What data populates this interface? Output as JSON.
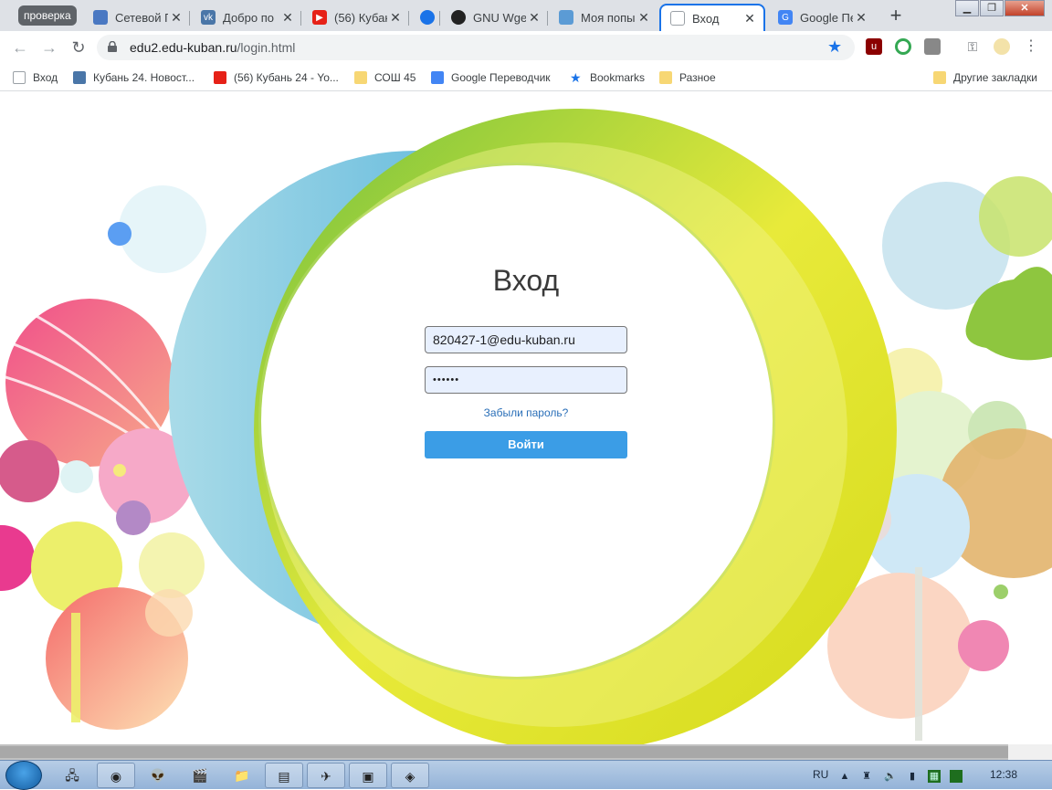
{
  "browser": {
    "tab_group_label": "проверка",
    "tabs": [
      {
        "title": "Сетевой Г",
        "icon": "grid-doc-icon"
      },
      {
        "title": "Добро по",
        "icon": "vk-icon"
      },
      {
        "title": "(56) Кубан",
        "icon": "youtube-icon"
      },
      {
        "title": "",
        "icon": "blue-dot-icon"
      },
      {
        "title": "GNU Wget",
        "icon": "gnu-icon"
      },
      {
        "title": "Моя попы",
        "icon": "puzzle-icon"
      },
      {
        "title": "Вход",
        "icon": "page-icon",
        "active": true
      },
      {
        "title": "Google Пе",
        "icon": "google-translate-icon"
      }
    ],
    "url_host": "edu2.edu-kuban.ru",
    "url_path": "/login.html",
    "bookmarks": [
      {
        "label": "Вход",
        "icon": "page-icon"
      },
      {
        "label": "Кубань 24. Новост...",
        "icon": "vk-icon"
      },
      {
        "label": "(56) Кубань 24 - Yo...",
        "icon": "youtube-icon"
      },
      {
        "label": "СОШ 45",
        "icon": "folder-icon"
      },
      {
        "label": "Google Переводчик",
        "icon": "google-translate-icon"
      },
      {
        "label": "Bookmarks",
        "icon": "star-icon"
      },
      {
        "label": "Разное",
        "icon": "folder-icon"
      },
      {
        "label": "Другие закладки",
        "icon": "folder-icon"
      }
    ]
  },
  "login": {
    "title": "Вход",
    "email_value": "820427-1@edu-kuban.ru",
    "password_mask": "••••••",
    "forgot_label": "Забыли пароль?",
    "submit_label": "Войти"
  },
  "taskbar": {
    "lang": "RU",
    "clock": "12:38"
  },
  "colors": {
    "button": "#3b9de6",
    "field_bg": "#e8f0fe",
    "link": "#2a6fb8"
  }
}
